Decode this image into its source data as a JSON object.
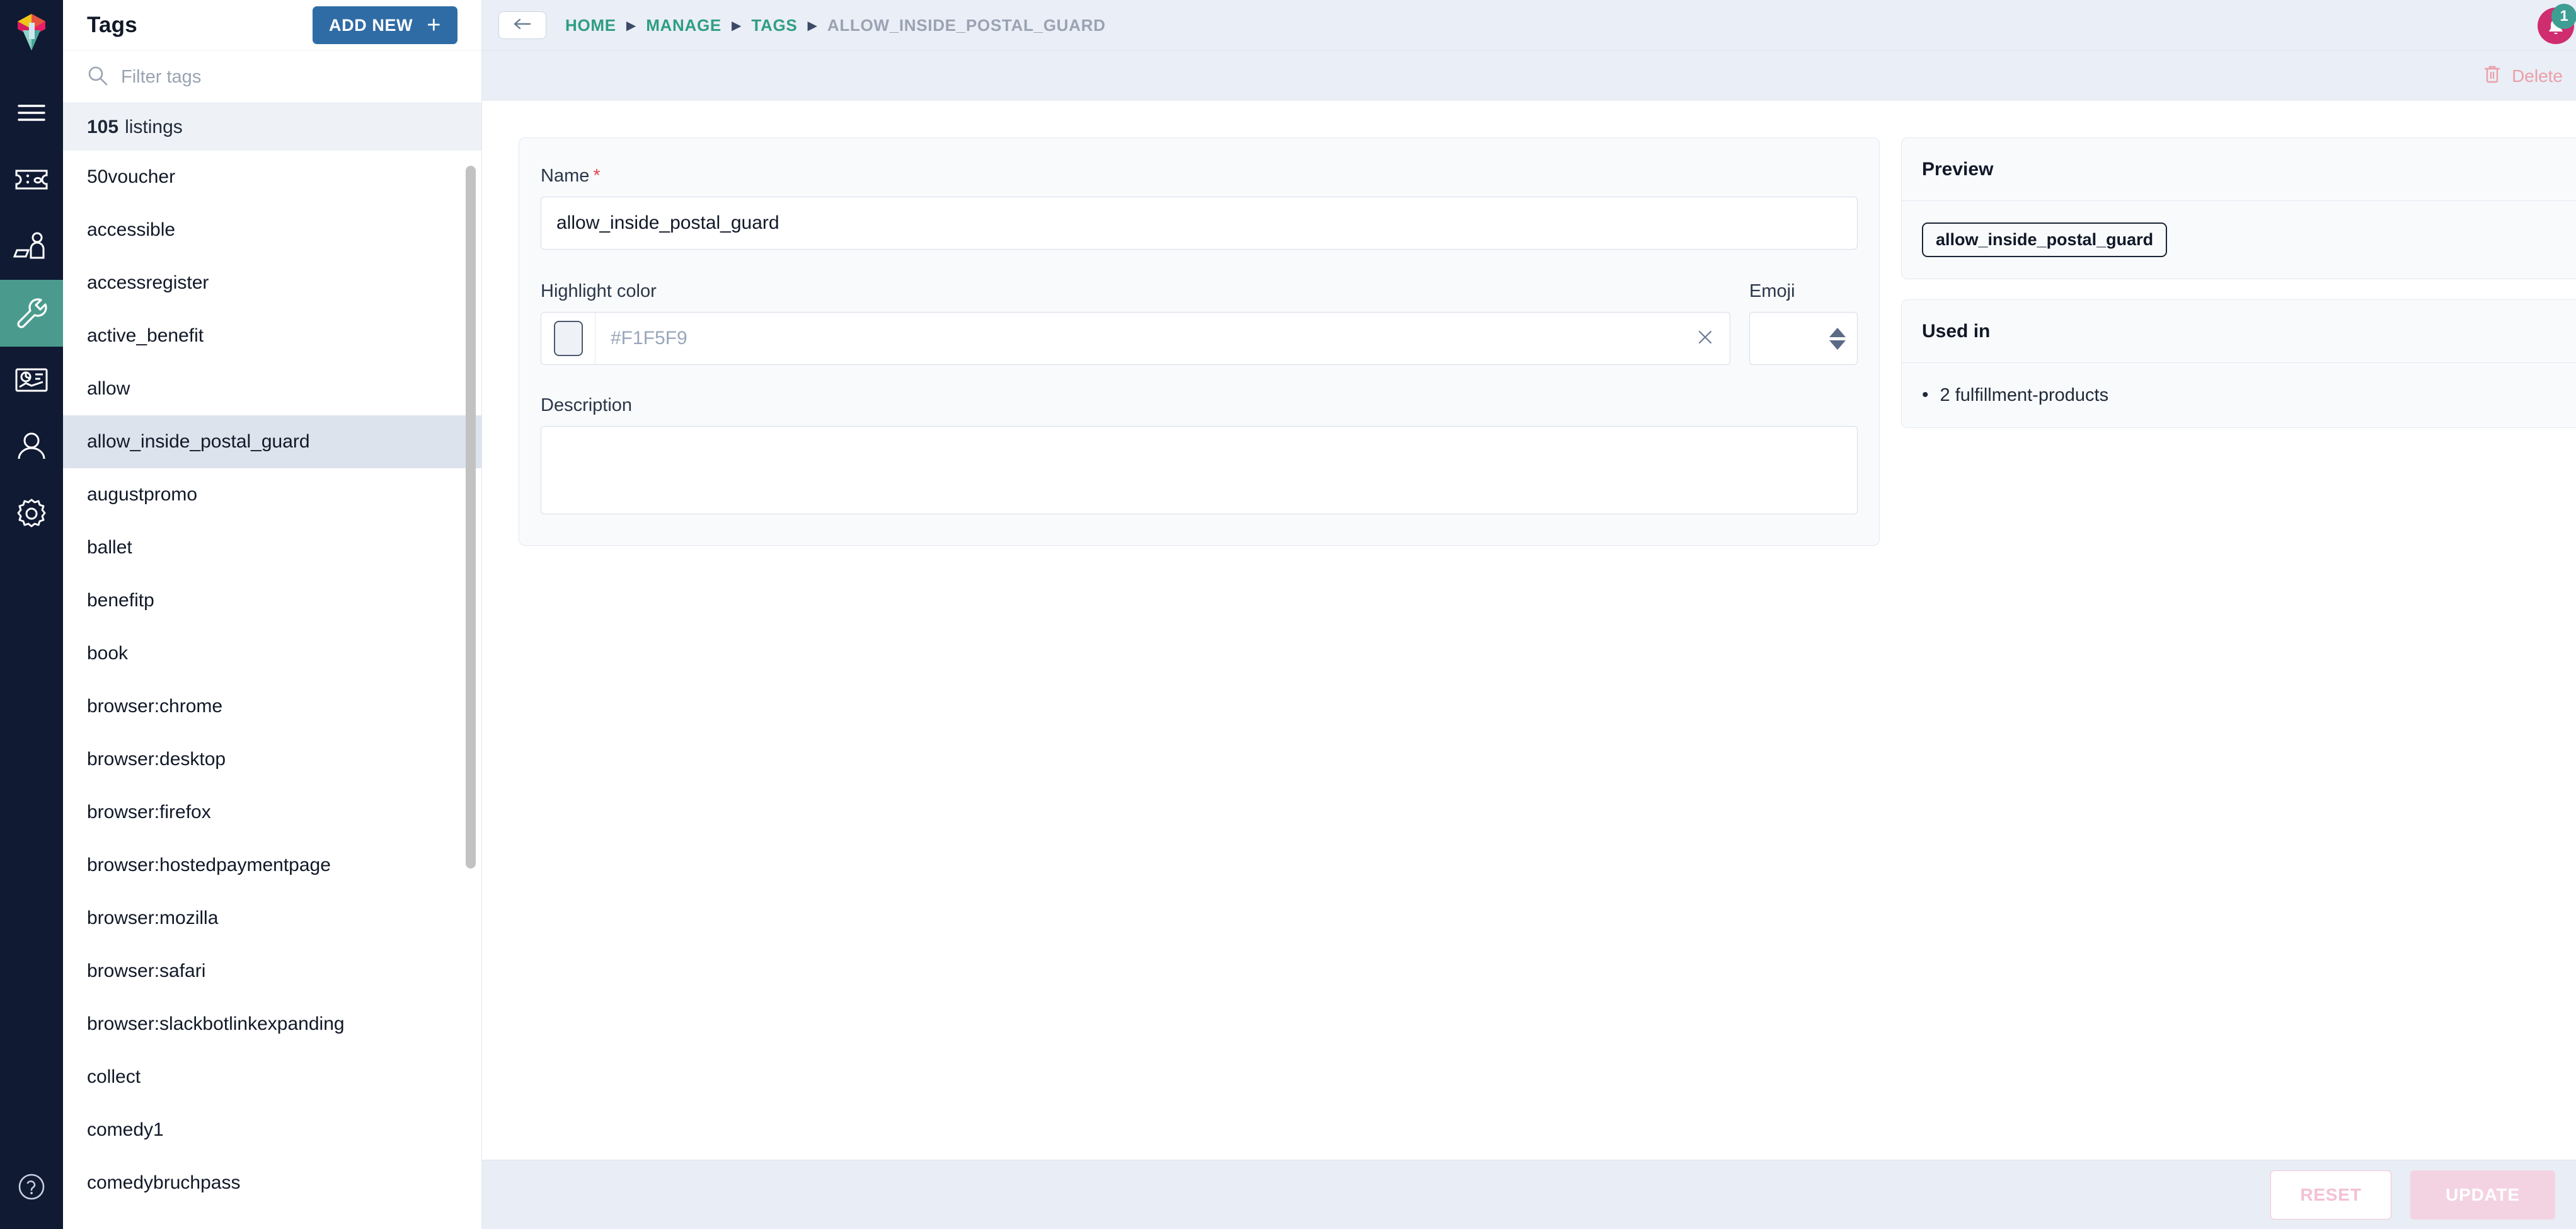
{
  "rail": {
    "logo_label": "app-logo",
    "items": [
      {
        "name": "menu-icon",
        "label": "Menu"
      },
      {
        "name": "ticket-icon",
        "label": "Tickets"
      },
      {
        "name": "delivery-person-icon",
        "label": "Fulfillment"
      },
      {
        "name": "wrench-icon",
        "label": "Manage"
      },
      {
        "name": "report-icon",
        "label": "Reports"
      },
      {
        "name": "user-icon",
        "label": "Customers"
      },
      {
        "name": "gear-icon",
        "label": "Settings"
      }
    ],
    "active_index": 3,
    "help_label": "Help"
  },
  "topbar": {
    "back_label": "Back",
    "breadcrumbs": [
      {
        "label": "HOME",
        "current": false
      },
      {
        "label": "MANAGE",
        "current": false
      },
      {
        "label": "TAGS",
        "current": false
      },
      {
        "label": "ALLOW_INSIDE_POSTAL_GUARD",
        "current": true
      }
    ],
    "separator": "▶",
    "notification_count": "1"
  },
  "subbar": {
    "delete_label": "Delete"
  },
  "tagpanel": {
    "title": "Tags",
    "add_new_label": "ADD NEW",
    "add_new_plus": "+",
    "filter_placeholder": "Filter tags",
    "filter_value": "",
    "listings_count": "105",
    "listings_word": "listings",
    "selected_tag": "allow_inside_postal_guard",
    "items": [
      "50voucher",
      "accessible",
      "accessregister",
      "active_benefit",
      "allow",
      "allow_inside_postal_guard",
      "augustpromo",
      "ballet",
      "benefitp",
      "book",
      "browser:chrome",
      "browser:desktop",
      "browser:firefox",
      "browser:hostedpaymentpage",
      "browser:mozilla",
      "browser:safari",
      "browser:slackbotlinkexpanding",
      "collect",
      "comedy1",
      "comedybruchpass"
    ]
  },
  "form": {
    "name_label": "Name",
    "name_required_mark": "*",
    "name_value": "allow_inside_postal_guard",
    "highlight_color_label": "Highlight color",
    "highlight_color_value": "",
    "highlight_color_placeholder": "#F1F5F9",
    "swatch_color": "#EEF2F7",
    "emoji_label": "Emoji",
    "emoji_value": "",
    "description_label": "Description",
    "description_value": ""
  },
  "preview": {
    "heading": "Preview",
    "chip_label": "allow_inside_postal_guard"
  },
  "used_in": {
    "heading": "Used in",
    "entries": [
      "2 fulfillment-products"
    ]
  },
  "actions": {
    "reset_label": "RESET",
    "update_label": "UPDATE"
  },
  "colors": {
    "rail_bg": "#101A33",
    "rail_active": "#4A9B8E",
    "accent_blue": "#2F6CA5",
    "breadcrumb_teal": "#2E9E82",
    "avatar_pink": "#CF2D6F",
    "badge_teal": "#3E9E93",
    "danger_pink": "#EB9FA8",
    "selected_row": "#DDE3ED"
  }
}
